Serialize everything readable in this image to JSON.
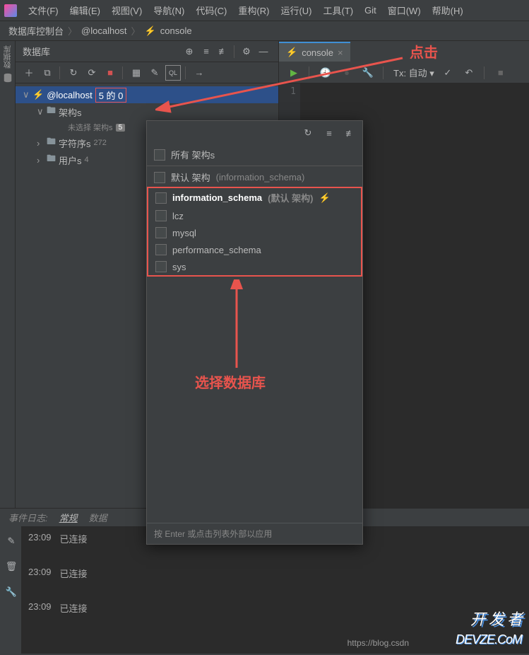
{
  "menu": {
    "items": [
      "文件(F)",
      "编辑(E)",
      "视图(V)",
      "导航(N)",
      "代码(C)",
      "重构(R)",
      "运行(U)",
      "工具(T)",
      "Git",
      "窗口(W)",
      "帮助(H)"
    ]
  },
  "breadcrumb": {
    "item1": "数据库控制台",
    "item2": "@localhost",
    "item3": "console"
  },
  "database_panel": {
    "title": "数据库",
    "vertical_label": "数据库"
  },
  "tree": {
    "localhost": "@localhost",
    "localhost_badge": "5 的 0",
    "schemas": "架构s",
    "schemas_hint": "未选择 架构s",
    "schemas_count": "5",
    "charsets": "字符序s",
    "charsets_count": "272",
    "users": "用户s",
    "users_count": "4"
  },
  "editor": {
    "tab_name": "console",
    "line_number": "1",
    "tx_label": "Tx: 自动"
  },
  "popup": {
    "all_schemas": "所有 架构s",
    "default_schema": "默认 架构",
    "default_hint": "(information_schema)",
    "items": [
      {
        "name": "information_schema",
        "hint": "(默认 架构)",
        "bold": true,
        "lightning": true
      },
      {
        "name": "lcz"
      },
      {
        "name": "mysql"
      },
      {
        "name": "performance_schema"
      },
      {
        "name": "sys"
      }
    ],
    "footer": "按 Enter 或点击列表外部以应用"
  },
  "bottom": {
    "event_log": "事件日志:",
    "tab1": "常规",
    "tab2": "数据",
    "log1_time": "23:09",
    "log1_text": "已连接",
    "log2_time": "23:09",
    "log2_text": "已连接",
    "log3_time": "23:09",
    "log3_text": "已连接"
  },
  "annotations": {
    "click": "点击",
    "select_db": "选择数据库"
  },
  "watermark": {
    "url": "https://blog.csdn",
    "logo1": "开 发 者",
    "logo2": "DEVZE.CoM"
  }
}
